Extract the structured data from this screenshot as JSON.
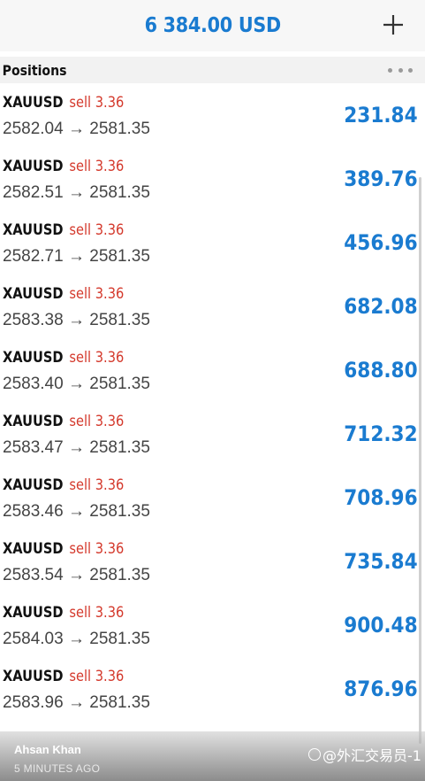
{
  "header": {
    "balance": "6 384.00 USD",
    "add_icon": "plus-icon"
  },
  "section": {
    "title": "Positions",
    "more_icon": "more-horizontal-icon"
  },
  "positions": [
    {
      "symbol": "XAUUSD",
      "side": "sell 3.36",
      "open": "2582.04",
      "current": "2581.35",
      "profit": "231.84"
    },
    {
      "symbol": "XAUUSD",
      "side": "sell 3.36",
      "open": "2582.51",
      "current": "2581.35",
      "profit": "389.76"
    },
    {
      "symbol": "XAUUSD",
      "side": "sell 3.36",
      "open": "2582.71",
      "current": "2581.35",
      "profit": "456.96"
    },
    {
      "symbol": "XAUUSD",
      "side": "sell 3.36",
      "open": "2583.38",
      "current": "2581.35",
      "profit": "682.08"
    },
    {
      "symbol": "XAUUSD",
      "side": "sell 3.36",
      "open": "2583.40",
      "current": "2581.35",
      "profit": "688.80"
    },
    {
      "symbol": "XAUUSD",
      "side": "sell 3.36",
      "open": "2583.47",
      "current": "2581.35",
      "profit": "712.32"
    },
    {
      "symbol": "XAUUSD",
      "side": "sell 3.36",
      "open": "2583.46",
      "current": "2581.35",
      "profit": "708.96"
    },
    {
      "symbol": "XAUUSD",
      "side": "sell 3.36",
      "open": "2583.54",
      "current": "2581.35",
      "profit": "735.84"
    },
    {
      "symbol": "XAUUSD",
      "side": "sell 3.36",
      "open": "2584.03",
      "current": "2581.35",
      "profit": "900.48"
    },
    {
      "symbol": "XAUUSD",
      "side": "sell 3.36",
      "open": "2583.96",
      "current": "2581.35",
      "profit": "876.96"
    }
  ],
  "arrow": "→",
  "footer": {
    "author": "Ahsan Khan",
    "time_ago": "5 MINUTES AGO",
    "watermark": "@外汇交易员-1"
  },
  "colors": {
    "profit": "#1a7bd0",
    "sell": "#d4392c",
    "balance": "#1a7bd0"
  }
}
